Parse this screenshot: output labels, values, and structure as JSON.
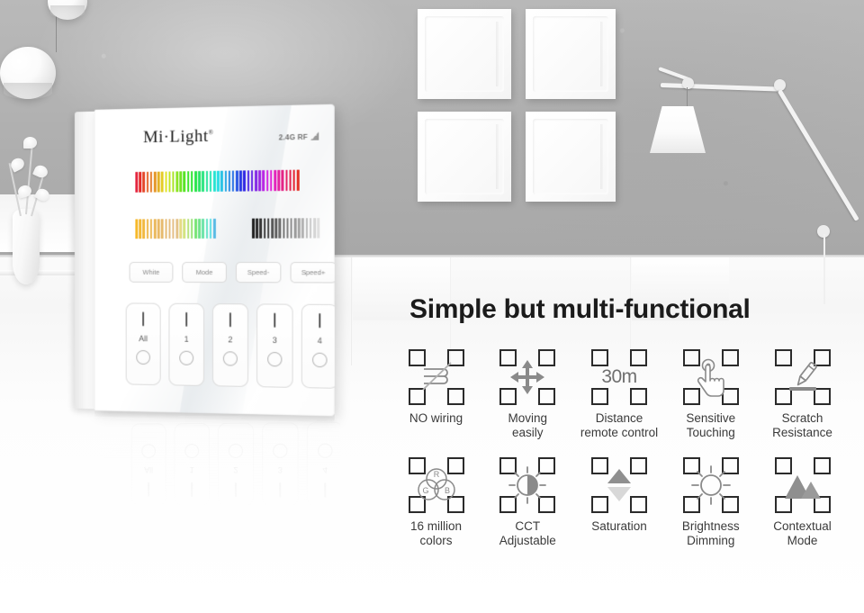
{
  "scene": {
    "wall_color": "#b0b0b0",
    "surface_color": "#fbfbfb",
    "wall_panels_count": 4,
    "pendant_lamps_count": 2,
    "desk_lamp": "articulated-white-desk-lamp",
    "vase": "white-vase-with-flowers"
  },
  "device": {
    "brand": "Mi·Light",
    "brand_trademark": "®",
    "rf_label": "2.4G RF",
    "rf_icon": "signal-wave-icon",
    "sliders": [
      {
        "name": "hue-slider",
        "segments": 44,
        "type": "rainbow"
      },
      {
        "name": "cct-slider",
        "segments": 22,
        "type": "warm-to-cool"
      },
      {
        "name": "dimming-slider",
        "segments": 18,
        "type": "dark-to-light"
      }
    ],
    "function_buttons": [
      {
        "label": "White",
        "name": "white-button"
      },
      {
        "label": "Mode",
        "name": "mode-button"
      },
      {
        "label": "Speed-",
        "name": "speed-down-button"
      },
      {
        "label": "Speed+",
        "name": "speed-up-button"
      }
    ],
    "zones": [
      {
        "label": "All",
        "name": "zone-all"
      },
      {
        "label": "1",
        "name": "zone-1"
      },
      {
        "label": "2",
        "name": "zone-2"
      },
      {
        "label": "3",
        "name": "zone-3"
      },
      {
        "label": "4",
        "name": "zone-4"
      }
    ]
  },
  "content": {
    "headline": "Simple but multi-functional",
    "features_row1": [
      {
        "icon": "no-wiring-icon",
        "line1": "NO wiring",
        "line2": ""
      },
      {
        "icon": "four-way-arrow-icon",
        "line1": "Moving",
        "line2": "easily"
      },
      {
        "icon": "distance-30m-icon",
        "text": "30m",
        "line1": "Distance",
        "line2": "remote control"
      },
      {
        "icon": "touch-hand-icon",
        "line1": "Sensitive",
        "line2": "Touching"
      },
      {
        "icon": "scratch-pen-icon",
        "line1": "Scratch",
        "line2": "Resistance"
      }
    ],
    "features_row2": [
      {
        "icon": "rgb-venn-icon",
        "line1": "16 million",
        "line2": "colors",
        "circles": [
          "R",
          "G",
          "B"
        ]
      },
      {
        "icon": "cct-half-sun-icon",
        "line1": "CCT",
        "line2": "Adjustable"
      },
      {
        "icon": "saturation-triangles-icon",
        "line1": "Saturation",
        "line2": ""
      },
      {
        "icon": "brightness-sun-icon",
        "line1": "Brightness",
        "line2": "Dimming"
      },
      {
        "icon": "mountains-icon",
        "line1": "Contextual",
        "line2": "Mode"
      }
    ]
  },
  "colors": {
    "icon_dark": "#2b2b2b",
    "icon_grey": "#8a8a8a",
    "label_text": "#3a3a3a",
    "headline_text": "#1b1b1b"
  }
}
